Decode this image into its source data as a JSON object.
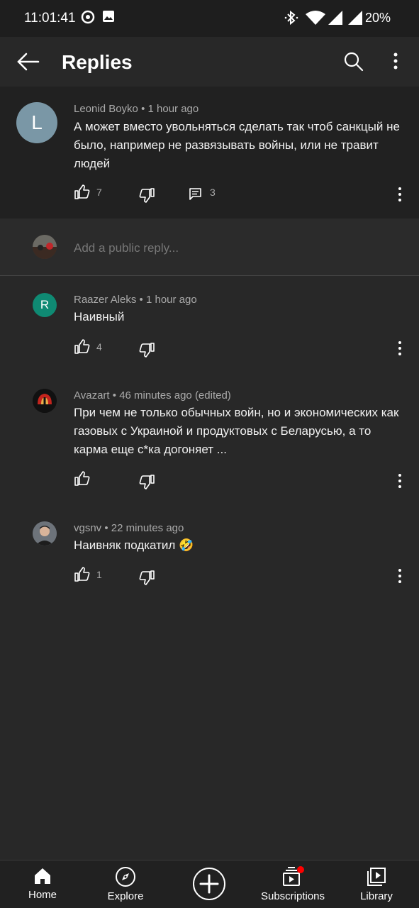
{
  "status_bar": {
    "time": "11:01:41",
    "battery": "20%"
  },
  "header": {
    "title": "Replies"
  },
  "parent_comment": {
    "author": "Leonid Boyko",
    "time": "1 hour ago",
    "avatar_letter": "L",
    "text": "А может вместо увольняться сделать так чтоб санкцый не было, например не развязывать войны, или не травит людей",
    "likes": "7",
    "replies": "3"
  },
  "reply_box": {
    "placeholder": "Add a public reply..."
  },
  "replies": [
    {
      "author": "Raazer Aleks",
      "time": "1 hour ago",
      "avatar_letter": "R",
      "text": "Наивный",
      "likes": "4"
    },
    {
      "author": "Avazart",
      "time": "46 minutes ago (edited)",
      "text": "При чем не только обычных войн, но и экономических как газовых с Украиной и продуктовых с Беларусью,  а то карма еще с*ка догоняет ...",
      "likes": ""
    },
    {
      "author": "vgsnv",
      "time": "22 minutes ago",
      "text": "Наивняк подкатил 🤣",
      "likes": "1"
    }
  ],
  "bottom_nav": {
    "home": "Home",
    "explore": "Explore",
    "subscriptions": "Subscriptions",
    "library": "Library"
  },
  "colors": {
    "background": "#282828",
    "parent_bg": "#212121",
    "avatar_L": "#7a97a6",
    "avatar_R": "#0f8a73",
    "notification_dot": "#ff0000"
  },
  "separator": "•"
}
